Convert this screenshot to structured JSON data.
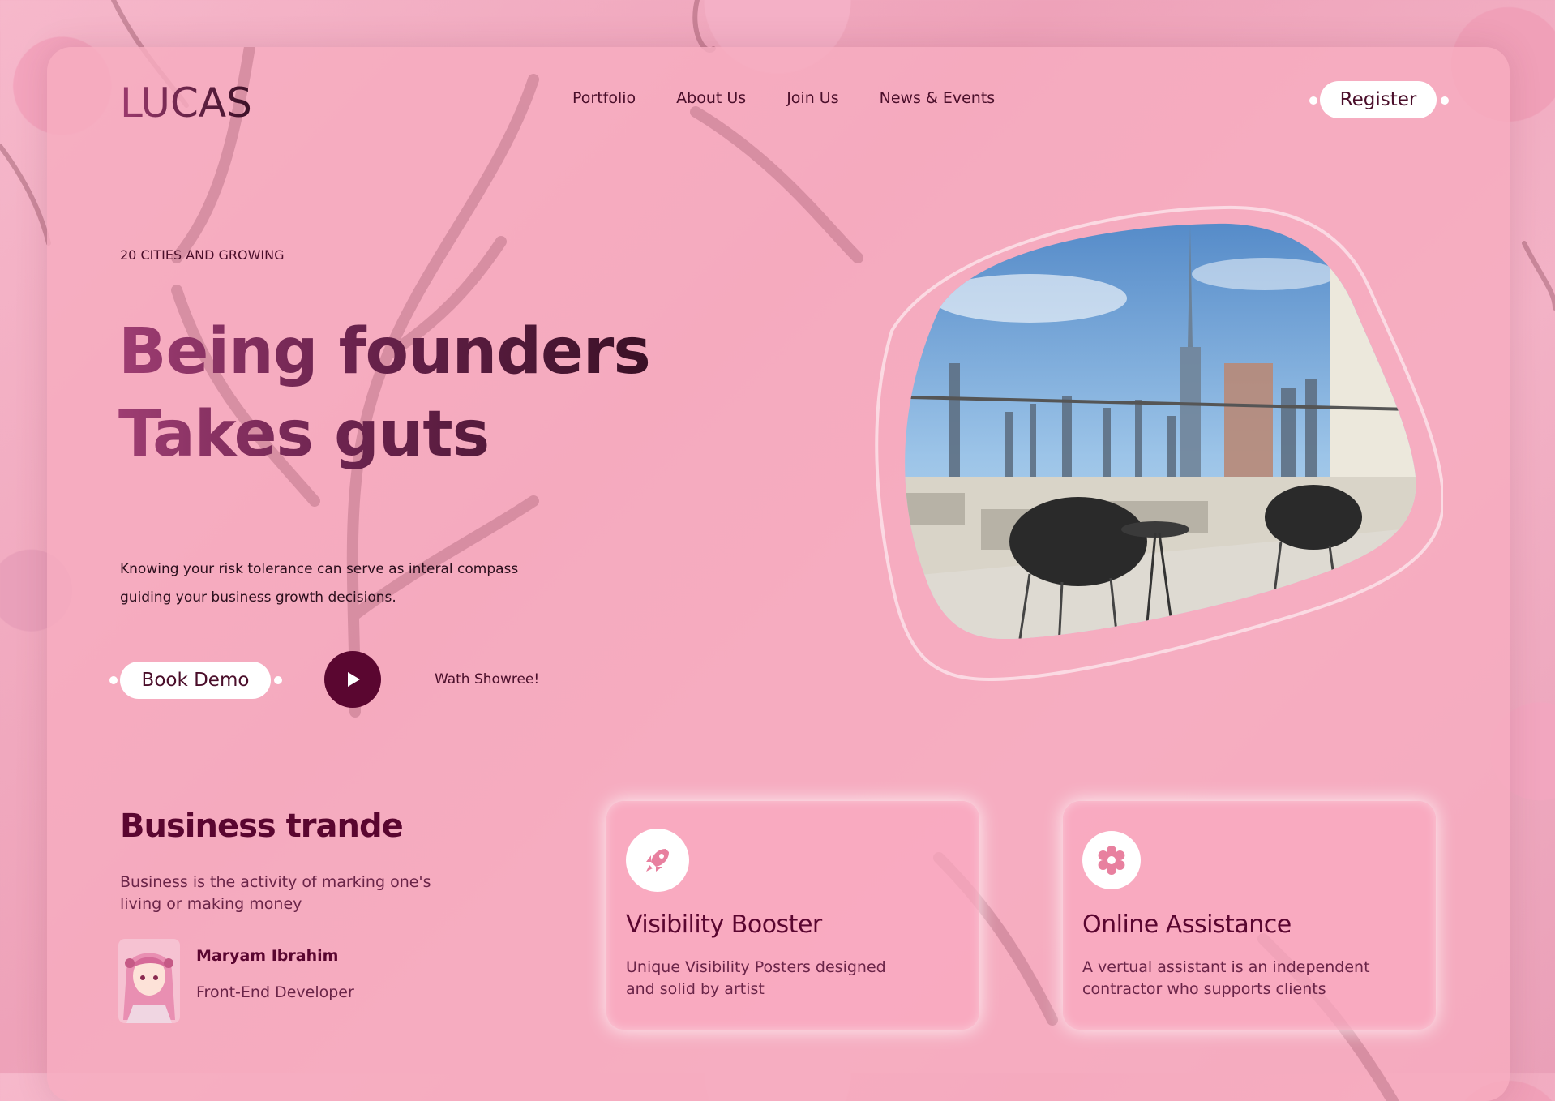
{
  "header": {
    "logo": "LUCAS",
    "nav": [
      "Portfolio",
      "About Us",
      "Join Us",
      "News & Events"
    ],
    "register_label": "Register"
  },
  "hero": {
    "eyebrow": "20 CITIES AND GROWING",
    "title_line1": "Being founders",
    "title_line2": "Takes guts",
    "description": "Knowing your risk tolerance can serve as interal compass guiding your business growth decisions.",
    "book_demo_label": "Book Demo",
    "showreel_label": "Wath Showree!"
  },
  "business": {
    "title": "Business trande",
    "description": "Business is the activity of marking one's living or making money",
    "author_name": "Maryam Ibrahim",
    "author_role": "Front-End Developer"
  },
  "features": [
    {
      "icon": "rocket-icon",
      "title": "Visibility Booster",
      "description": "Unique Visibility Posters designed and solid by artist"
    },
    {
      "icon": "gear-icon",
      "title": "Online Assistance",
      "description": "A vertual assistant is an independent contractor who supports clients"
    }
  ],
  "colors": {
    "accent": "#5a0630",
    "card_bg": "#f7acc0",
    "text": "#4a0e2a"
  }
}
